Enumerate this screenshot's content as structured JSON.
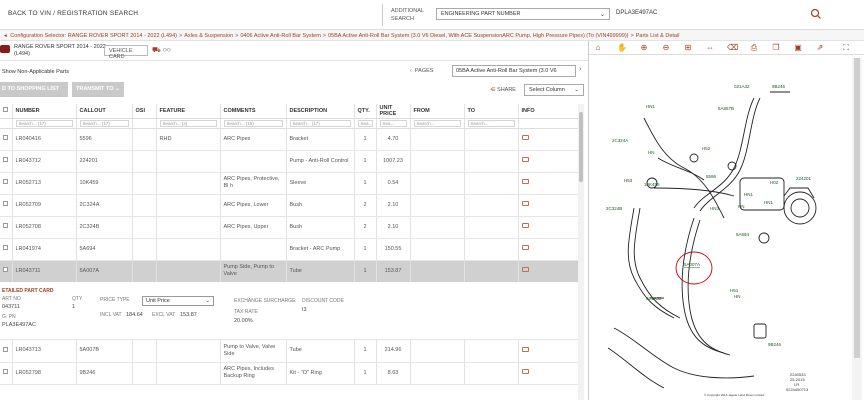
{
  "topbar": {
    "back_link": "BACK TO VIN / REGISTRATION SEARCH",
    "additional_search_label": "ADDITIONAL SEARCH",
    "search_type": "ENGINEERING PART NUMBER",
    "search_value": "DPLA3E497AC"
  },
  "breadcrumb": [
    "Configuration Selector: RANGE ROVER SPORT 2014 - 2022 (L494)",
    "Axles & Suspension",
    "0406 Active Anti-Roll Bar System",
    "05BA Active Anti-Roll Bar System (3.0 V6 Diesel, With ACE SuspensionARC Pump, High Pressure Pipes) (To (VIN499999))",
    "Parts List & Detail"
  ],
  "breadcrumb_sep": ">",
  "vehicle": {
    "name_line1": "RANGE ROVER SPORT 2014 - 2022",
    "name_line2": "(L494)",
    "card_button": "VEHICLE CARD"
  },
  "controls": {
    "show_non_applicable": "Show Non-Applicable Parts",
    "add_to_list": "D TO SHOPPING LIST",
    "transmit": "TRANSMIT TO",
    "pages_label": "PAGES",
    "pages_value": "05BA Active Anti-Roll Bar System (3.0 V6",
    "share": "SHARE",
    "select_column": "Select Column"
  },
  "table": {
    "headers": [
      "",
      "NUMBER",
      "CALLOUT",
      "OSI",
      "FEATURE",
      "COMMENTS",
      "DESCRIPTION",
      "QTY.",
      "UNIT PRICE",
      "FROM",
      "TO",
      "INFO"
    ],
    "filters": [
      "Search... (17)",
      "Search... (17)",
      "",
      "Search... (2)",
      "Search... (16)",
      "Search... (17)",
      "Sea...",
      "Sea...",
      "Search...",
      "Search...",
      ""
    ],
    "rows": [
      {
        "number": "LR040416",
        "callout": "5596",
        "feature": "RHD",
        "comments": "ARC Pipes",
        "description": "Bracket",
        "qty": "1",
        "price": "4.70",
        "selected": false
      },
      {
        "number": "LR043712",
        "callout": "224201",
        "feature": "",
        "comments": "",
        "description": "Pump - Anti-Roll Control",
        "qty": "1",
        "price": "1007.23",
        "selected": false
      },
      {
        "number": "LR052713",
        "callout": "10K459",
        "feature": "",
        "comments": "ARC Pipes, Protective, Bl h",
        "description": "Sleeve",
        "qty": "1",
        "price": "0.54",
        "selected": false
      },
      {
        "number": "LR052709",
        "callout": "2C324A",
        "feature": "",
        "comments": "ARC Pipes, Lower",
        "description": "Bush",
        "qty": "2",
        "price": "2.10",
        "selected": false
      },
      {
        "number": "LR052708",
        "callout": "2C324B",
        "feature": "",
        "comments": "ARC Pipes, Upper",
        "description": "Bush",
        "qty": "2",
        "price": "2.10",
        "selected": false
      },
      {
        "number": "LR041974",
        "callout": "5A694",
        "feature": "",
        "comments": "",
        "description": "Bracket - ARC Pump",
        "qty": "1",
        "price": "150.55",
        "selected": false
      },
      {
        "number": "LR043711",
        "callout": "5A007A",
        "feature": "",
        "comments": "Pump Side, Pump to Valve",
        "description": "Tube",
        "qty": "1",
        "price": "153.87",
        "selected": true
      }
    ],
    "rows_after": [
      {
        "number": "LR043713",
        "callout": "5A007B",
        "feature": "",
        "comments": "Pump to Valve, Valve Side",
        "description": "Tube",
        "qty": "1",
        "price": "214.96",
        "selected": false
      },
      {
        "number": "LR052798",
        "callout": "9B246",
        "feature": "",
        "comments": "ARC Pipes, Includes Backup Ring",
        "description": "Kit - \"O\" Ring",
        "qty": "1",
        "price": "8.63",
        "selected": false
      }
    ]
  },
  "detail": {
    "title": "ETAILED PART CARD",
    "part_no_label": "ART NO",
    "part_no": "043711",
    "eng_pn_label": "G. PN",
    "eng_pn": "PLA3E497AC",
    "qty_label": "QTY",
    "qty": "1",
    "price_type_label": "PRICE TYPE",
    "price_type": "Unit Price",
    "incl_vat_label": "INCL VAT",
    "incl_vat": "184.64",
    "excl_vat_label": "EXCL VAT",
    "excl_vat": "153.87",
    "exchange_label": "EXCHANGE SURCHARGE",
    "tax_label": "TAX RATE",
    "tax": "20.00%",
    "discount_label": "DISCOUNT CODE",
    "discount": "I3"
  },
  "diagram": {
    "callouts": [
      "HN1",
      "5A857B",
      "9B246",
      "2C324A",
      "H52",
      "HN",
      "H53",
      "5596",
      "10K459",
      "H02",
      "224201",
      "HN1",
      "2C324B",
      "HN",
      "HN3",
      "HN1",
      "5A694",
      "5A007A",
      "H51",
      "HN",
      "021A32",
      "021A32",
      "9B246"
    ],
    "footer_lines": [
      "2240533",
      "25-2015",
      "LR",
      "0224450713"
    ],
    "copyright": "© Copyright 2015 Jaguar Land Rover Limited"
  },
  "colors": {
    "accent": "#a04020",
    "part_number": "#3a8a3a",
    "selected_row": "#d0d0d0"
  }
}
